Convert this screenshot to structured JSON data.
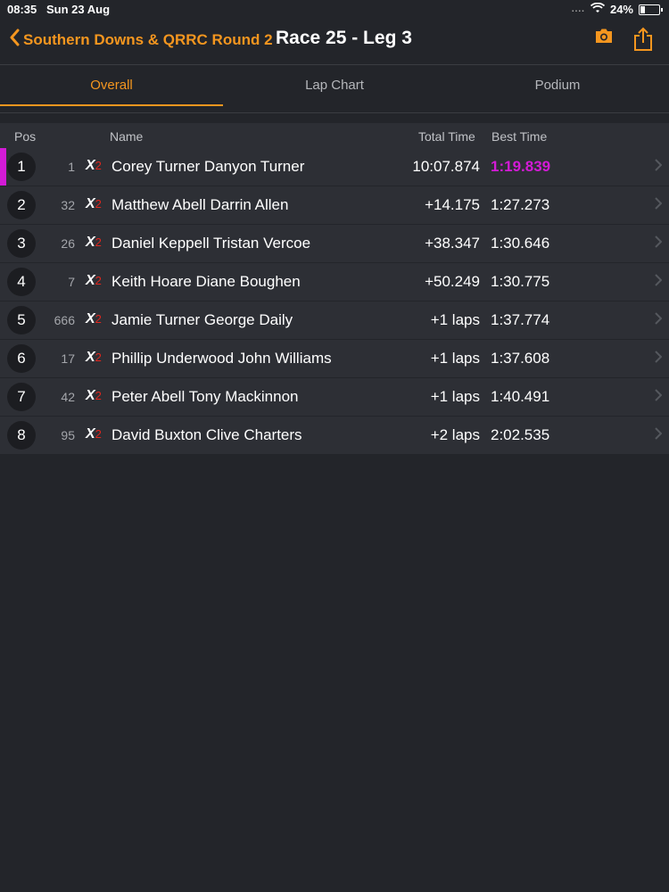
{
  "status_bar": {
    "time": "08:35",
    "date": "Sun 23 Aug",
    "signal": "....",
    "battery": "24%"
  },
  "nav": {
    "back_label": "Southern Downs & QRRC Round 2",
    "title": "Race 25 - Leg 3"
  },
  "tabs": [
    {
      "label": "Overall",
      "active": true
    },
    {
      "label": "Lap Chart",
      "active": false
    },
    {
      "label": "Podium",
      "active": false
    }
  ],
  "table": {
    "headers": {
      "pos": "Pos",
      "name": "Name",
      "total_time": "Total Time",
      "best_time": "Best Time"
    },
    "rows": [
      {
        "pos": "1",
        "number": "1",
        "class": "X",
        "class_sub": "2",
        "name": "Corey Turner Danyon Turner",
        "total": "10:07.874",
        "best": "1:19.839"
      },
      {
        "pos": "2",
        "number": "32",
        "class": "X",
        "class_sub": "2",
        "name": "Matthew Abell Darrin Allen",
        "total": "+14.175",
        "best": "1:27.273"
      },
      {
        "pos": "3",
        "number": "26",
        "class": "X",
        "class_sub": "2",
        "name": "Daniel Keppell Tristan Vercoe",
        "total": "+38.347",
        "best": "1:30.646"
      },
      {
        "pos": "4",
        "number": "7",
        "class": "X",
        "class_sub": "2",
        "name": "Keith Hoare Diane Boughen",
        "total": "+50.249",
        "best": "1:30.775"
      },
      {
        "pos": "5",
        "number": "666",
        "class": "X",
        "class_sub": "2",
        "name": "Jamie Turner George Daily",
        "total": "+1 laps",
        "best": "1:37.774"
      },
      {
        "pos": "6",
        "number": "17",
        "class": "X",
        "class_sub": "2",
        "name": "Phillip Underwood John Williams",
        "total": "+1 laps",
        "best": "1:37.608"
      },
      {
        "pos": "7",
        "number": "42",
        "class": "X",
        "class_sub": "2",
        "name": "Peter Abell Tony Mackinnon",
        "total": "+1 laps",
        "best": "1:40.491"
      },
      {
        "pos": "8",
        "number": "95",
        "class": "X",
        "class_sub": "2",
        "name": "David Buxton Clive Charters",
        "total": "+2 laps",
        "best": "2:02.535"
      }
    ]
  },
  "colors": {
    "accent": "#f4961f",
    "fastest": "#d31bd6",
    "background": "#23252a",
    "row": "#2d2f35",
    "class_sub": "#e0261d"
  },
  "icons": {
    "back": "chevron-left-icon",
    "camera": "camera-icon",
    "share": "share-icon",
    "row": "chevron-right-icon"
  }
}
